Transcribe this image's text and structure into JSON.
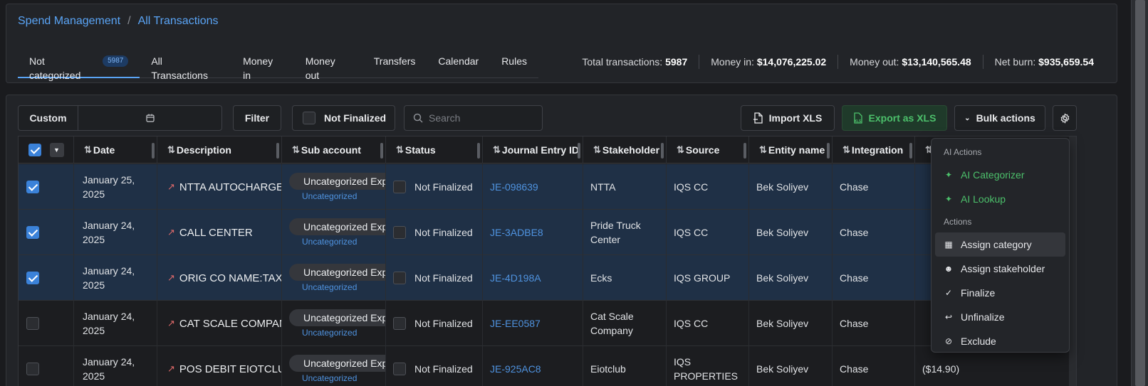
{
  "breadcrumb": {
    "parent": "Spend Management",
    "separator": "/",
    "current": "All Transactions"
  },
  "tabs": [
    {
      "label": "Not categorized",
      "badge": "5987"
    },
    {
      "label": "All Transactions"
    },
    {
      "label": "Money in"
    },
    {
      "label": "Money out"
    },
    {
      "label": "Transfers"
    },
    {
      "label": "Calendar"
    },
    {
      "label": "Rules"
    }
  ],
  "stats": [
    {
      "label": "Total transactions:",
      "value": "5987"
    },
    {
      "label": "Money in:",
      "value": "$14,076,225.02"
    },
    {
      "label": "Money out:",
      "value": "$13,140,565.48"
    },
    {
      "label": "Net burn:",
      "value": "$935,659.54"
    }
  ],
  "toolbar": {
    "date_mode": "Custom",
    "filter_label": "Filter",
    "not_finalized_label": "Not Finalized",
    "search_placeholder": "Search",
    "import_label": "Import XLS",
    "export_label": "Export as XLS",
    "bulk_label": "Bulk actions"
  },
  "columns": [
    "Date",
    "Description",
    "Sub account",
    "Status",
    "Journal Entry ID",
    "Stakeholder",
    "Source",
    "Entity name",
    "Integration"
  ],
  "rows": [
    {
      "selected": true,
      "date": "January 25, 2025",
      "description": "NTTA AUTOCHARGE",
      "sub_account": "Uncategorized Expe",
      "sub_label": "Uncategorized",
      "status": "Not Finalized",
      "je_id": "JE-098639",
      "stakeholder": "NTTA",
      "source": "IQS CC",
      "entity": "Bek Soliyev",
      "integration": "Chase",
      "amount": ""
    },
    {
      "selected": true,
      "date": "January 24, 2025",
      "description": "CALL CENTER",
      "sub_account": "Uncategorized Expe",
      "sub_label": "Uncategorized",
      "status": "Not Finalized",
      "je_id": "JE-3ADBE8",
      "stakeholder": "Pride Truck Center",
      "source": "IQS CC",
      "entity": "Bek Soliyev",
      "integration": "Chase",
      "amount": ""
    },
    {
      "selected": true,
      "date": "January 24, 2025",
      "description": "ORIG CO NAME:TAX_",
      "sub_account": "Uncategorized Expe",
      "sub_label": "Uncategorized",
      "status": "Not Finalized",
      "je_id": "JE-4D198A",
      "stakeholder": "Ecks",
      "source": "IQS GROUP",
      "entity": "Bek Soliyev",
      "integration": "Chase",
      "amount": ""
    },
    {
      "selected": false,
      "date": "January 24, 2025",
      "description": "CAT SCALE COMPANY",
      "sub_account": "Uncategorized Expe",
      "sub_label": "Uncategorized",
      "status": "Not Finalized",
      "je_id": "JE-EE0587",
      "stakeholder": "Cat Scale Company",
      "source": "IQS CC",
      "entity": "Bek Soliyev",
      "integration": "Chase",
      "amount": ""
    },
    {
      "selected": false,
      "date": "January 24, 2025",
      "description": "POS DEBIT EIOTCLUB",
      "sub_account": "Uncategorized Expe",
      "sub_label": "Uncategorized",
      "status": "Not Finalized",
      "je_id": "JE-925AC8",
      "stakeholder": "Eiotclub",
      "source": "IQS PROPERTIES",
      "entity": "Bek Soliyev",
      "integration": "Chase",
      "amount": "($14.90)"
    }
  ],
  "bulk_menu": {
    "ai_section": "AI Actions",
    "ai_items": [
      "AI Categorizer",
      "AI Lookup"
    ],
    "actions_section": "Actions",
    "action_items": [
      "Assign category",
      "Assign stakeholder",
      "Finalize",
      "Unfinalize",
      "Exclude"
    ]
  },
  "colors": {
    "accent": "#5aa4f5",
    "selected_row": "#1f3046",
    "ai_green": "#4cc06b",
    "export_bg": "#1f3a2a"
  }
}
